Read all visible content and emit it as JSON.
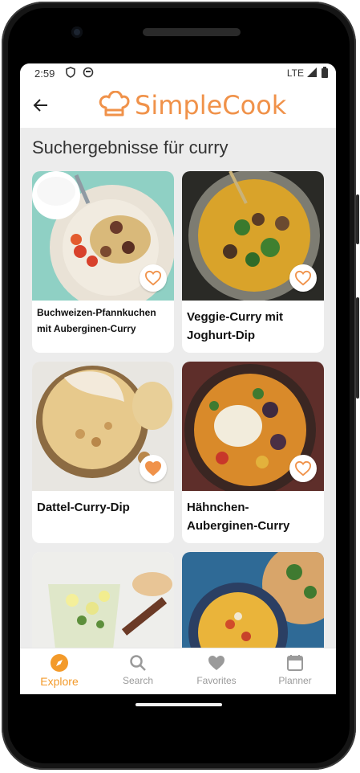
{
  "status": {
    "time": "2:59",
    "network": "LTE"
  },
  "app": {
    "title": "SimpleCook"
  },
  "heading": "Suchergebnisse für curry",
  "recipes": [
    {
      "title": "Buchweizen-Pfannkuchen mit Auberginen-Curry",
      "favorite": false
    },
    {
      "title": "Veggie-Curry mit Joghurt-Dip",
      "favorite": false
    },
    {
      "title": "Dattel-Curry-Dip",
      "favorite": true
    },
    {
      "title": "Hähnchen-Auberginen-Curry",
      "favorite": false
    },
    {
      "title": "",
      "favorite": false
    },
    {
      "title": "",
      "favorite": false
    }
  ],
  "nav": [
    {
      "label": "Explore",
      "icon": "compass-icon",
      "active": true
    },
    {
      "label": "Search",
      "icon": "search-icon",
      "active": false
    },
    {
      "label": "Favorites",
      "icon": "heart-icon",
      "active": false
    },
    {
      "label": "Planner",
      "icon": "calendar-icon",
      "active": false
    }
  ],
  "colors": {
    "brand": "#f0924a",
    "active": "#f39a2a",
    "inactive": "#9a9a9a"
  }
}
